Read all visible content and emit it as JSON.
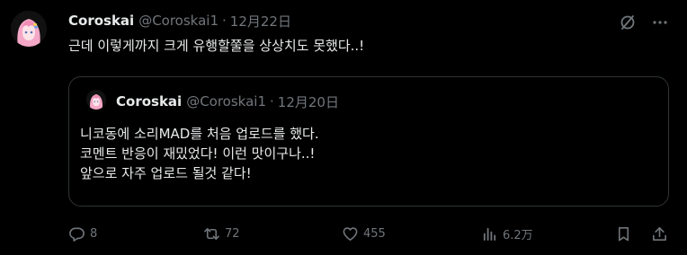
{
  "tweet": {
    "author_name": "Coroskai",
    "handle": "@Coroskai1",
    "separator": "·",
    "date": "12月22日",
    "text": "근데 이렇게까지 크게 유행할쭐을 상상치도 못했다..!"
  },
  "quote": {
    "author_name": "Coroskai",
    "handle": "@Coroskai1",
    "separator": "·",
    "date": "12月20日",
    "lines": [
      "니코동에 소리MAD를 처음 업로드를 했다.",
      "코멘트 반응이 재밌었다! 이런 맛이구나..!",
      "앞으로 자주 업로드 될것 같다!"
    ]
  },
  "actions": {
    "replies": "8",
    "reposts": "72",
    "likes": "455",
    "views": "6.2万"
  },
  "icons": {
    "grok": "grok-icon",
    "more": "more-icon",
    "reply": "reply-icon",
    "repost": "repost-icon",
    "like": "heart-icon",
    "views": "views-icon",
    "bookmark": "bookmark-icon",
    "share": "share-icon"
  },
  "colors": {
    "background": "#000000",
    "text": "#e7e9ea",
    "muted": "#71767b",
    "border": "#2f3336",
    "avatar_hair": "#f4a7c6"
  }
}
